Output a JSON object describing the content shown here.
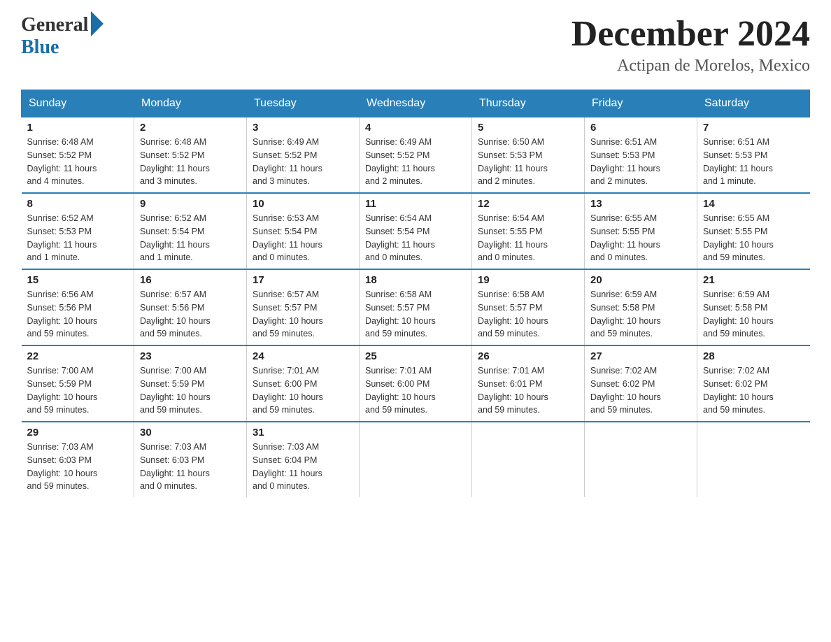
{
  "logo": {
    "general": "General",
    "blue": "Blue"
  },
  "title": "December 2024",
  "location": "Actipan de Morelos, Mexico",
  "weekdays": [
    "Sunday",
    "Monday",
    "Tuesday",
    "Wednesday",
    "Thursday",
    "Friday",
    "Saturday"
  ],
  "weeks": [
    [
      {
        "day": "1",
        "info": "Sunrise: 6:48 AM\nSunset: 5:52 PM\nDaylight: 11 hours\nand 4 minutes."
      },
      {
        "day": "2",
        "info": "Sunrise: 6:48 AM\nSunset: 5:52 PM\nDaylight: 11 hours\nand 3 minutes."
      },
      {
        "day": "3",
        "info": "Sunrise: 6:49 AM\nSunset: 5:52 PM\nDaylight: 11 hours\nand 3 minutes."
      },
      {
        "day": "4",
        "info": "Sunrise: 6:49 AM\nSunset: 5:52 PM\nDaylight: 11 hours\nand 2 minutes."
      },
      {
        "day": "5",
        "info": "Sunrise: 6:50 AM\nSunset: 5:53 PM\nDaylight: 11 hours\nand 2 minutes."
      },
      {
        "day": "6",
        "info": "Sunrise: 6:51 AM\nSunset: 5:53 PM\nDaylight: 11 hours\nand 2 minutes."
      },
      {
        "day": "7",
        "info": "Sunrise: 6:51 AM\nSunset: 5:53 PM\nDaylight: 11 hours\nand 1 minute."
      }
    ],
    [
      {
        "day": "8",
        "info": "Sunrise: 6:52 AM\nSunset: 5:53 PM\nDaylight: 11 hours\nand 1 minute."
      },
      {
        "day": "9",
        "info": "Sunrise: 6:52 AM\nSunset: 5:54 PM\nDaylight: 11 hours\nand 1 minute."
      },
      {
        "day": "10",
        "info": "Sunrise: 6:53 AM\nSunset: 5:54 PM\nDaylight: 11 hours\nand 0 minutes."
      },
      {
        "day": "11",
        "info": "Sunrise: 6:54 AM\nSunset: 5:54 PM\nDaylight: 11 hours\nand 0 minutes."
      },
      {
        "day": "12",
        "info": "Sunrise: 6:54 AM\nSunset: 5:55 PM\nDaylight: 11 hours\nand 0 minutes."
      },
      {
        "day": "13",
        "info": "Sunrise: 6:55 AM\nSunset: 5:55 PM\nDaylight: 11 hours\nand 0 minutes."
      },
      {
        "day": "14",
        "info": "Sunrise: 6:55 AM\nSunset: 5:55 PM\nDaylight: 10 hours\nand 59 minutes."
      }
    ],
    [
      {
        "day": "15",
        "info": "Sunrise: 6:56 AM\nSunset: 5:56 PM\nDaylight: 10 hours\nand 59 minutes."
      },
      {
        "day": "16",
        "info": "Sunrise: 6:57 AM\nSunset: 5:56 PM\nDaylight: 10 hours\nand 59 minutes."
      },
      {
        "day": "17",
        "info": "Sunrise: 6:57 AM\nSunset: 5:57 PM\nDaylight: 10 hours\nand 59 minutes."
      },
      {
        "day": "18",
        "info": "Sunrise: 6:58 AM\nSunset: 5:57 PM\nDaylight: 10 hours\nand 59 minutes."
      },
      {
        "day": "19",
        "info": "Sunrise: 6:58 AM\nSunset: 5:57 PM\nDaylight: 10 hours\nand 59 minutes."
      },
      {
        "day": "20",
        "info": "Sunrise: 6:59 AM\nSunset: 5:58 PM\nDaylight: 10 hours\nand 59 minutes."
      },
      {
        "day": "21",
        "info": "Sunrise: 6:59 AM\nSunset: 5:58 PM\nDaylight: 10 hours\nand 59 minutes."
      }
    ],
    [
      {
        "day": "22",
        "info": "Sunrise: 7:00 AM\nSunset: 5:59 PM\nDaylight: 10 hours\nand 59 minutes."
      },
      {
        "day": "23",
        "info": "Sunrise: 7:00 AM\nSunset: 5:59 PM\nDaylight: 10 hours\nand 59 minutes."
      },
      {
        "day": "24",
        "info": "Sunrise: 7:01 AM\nSunset: 6:00 PM\nDaylight: 10 hours\nand 59 minutes."
      },
      {
        "day": "25",
        "info": "Sunrise: 7:01 AM\nSunset: 6:00 PM\nDaylight: 10 hours\nand 59 minutes."
      },
      {
        "day": "26",
        "info": "Sunrise: 7:01 AM\nSunset: 6:01 PM\nDaylight: 10 hours\nand 59 minutes."
      },
      {
        "day": "27",
        "info": "Sunrise: 7:02 AM\nSunset: 6:02 PM\nDaylight: 10 hours\nand 59 minutes."
      },
      {
        "day": "28",
        "info": "Sunrise: 7:02 AM\nSunset: 6:02 PM\nDaylight: 10 hours\nand 59 minutes."
      }
    ],
    [
      {
        "day": "29",
        "info": "Sunrise: 7:03 AM\nSunset: 6:03 PM\nDaylight: 10 hours\nand 59 minutes."
      },
      {
        "day": "30",
        "info": "Sunrise: 7:03 AM\nSunset: 6:03 PM\nDaylight: 11 hours\nand 0 minutes."
      },
      {
        "day": "31",
        "info": "Sunrise: 7:03 AM\nSunset: 6:04 PM\nDaylight: 11 hours\nand 0 minutes."
      },
      null,
      null,
      null,
      null
    ]
  ]
}
